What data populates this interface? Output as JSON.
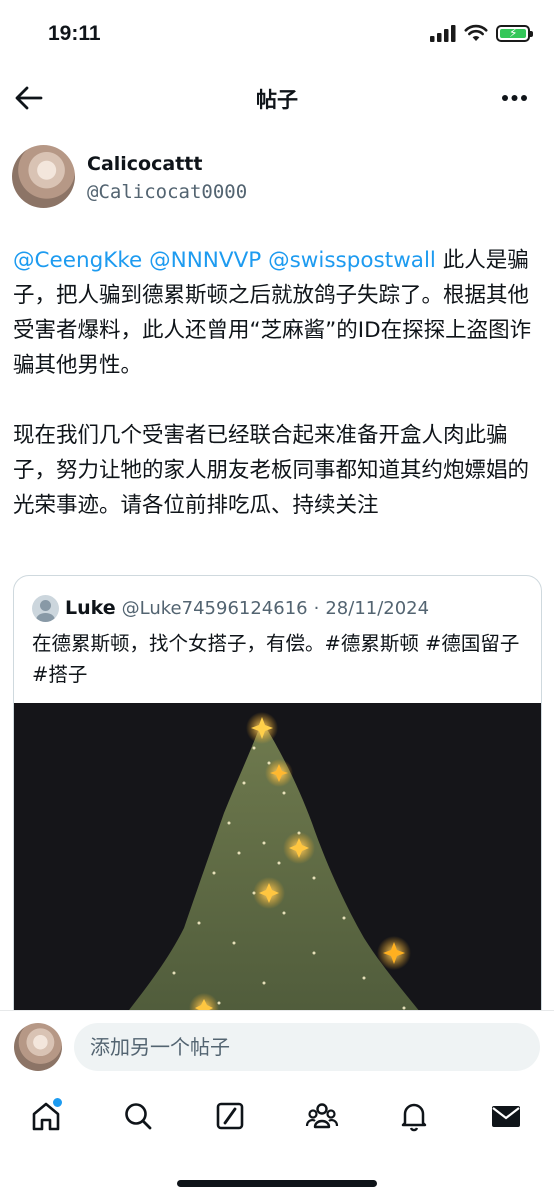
{
  "status_bar": {
    "time": "19:11"
  },
  "nav": {
    "title": "帖子"
  },
  "author": {
    "name": "Calicocattt",
    "handle": "@Calicocat0000"
  },
  "tweet": {
    "paragraph1": {
      "mention1": "@CeengKke",
      "mention2": "@NNNVVP",
      "mention3": "@swisspostwall",
      "text": "此人是骗子，把人骗到德累斯顿之后就放鸽子失踪了。根据其他受害者爆料，此人还曾用“芝麻酱”的ID在探探上盗图诈骗其他男性。"
    },
    "paragraph2": "现在我们几个受害者已经联合起来准备开盒人肉此骗子，努力让牠的家人朋友老板同事都知道其约炮嫖娼的光荣事迹。请各位前排吃瓜、持续关注"
  },
  "quote": {
    "name": "Luke",
    "handle": "@Luke74596124616",
    "separator": "·",
    "date": "28/11/2024",
    "text": "在德累斯顿，找个女搭子，有偿。#德累斯顿 #德国留子 #搭子"
  },
  "reply": {
    "placeholder": "添加另一个帖子"
  },
  "tabs": [
    "home-icon",
    "search-icon",
    "grok-icon",
    "communities-icon",
    "notifications-icon",
    "messages-icon"
  ],
  "colors": {
    "accent": "#1d9bf0",
    "text": "#0f1419",
    "secondary": "#536471",
    "battery": "#34c759"
  }
}
